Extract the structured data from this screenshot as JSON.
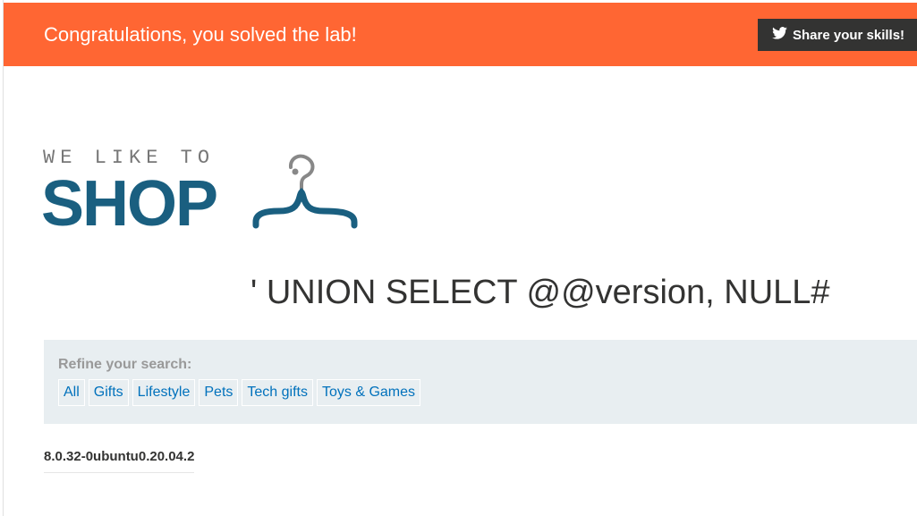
{
  "banner": {
    "message": "Congratulations, you solved the lab!",
    "share_label": "Share your skills!",
    "background_color": "#ff6633",
    "share_icon": "twitter-icon"
  },
  "logo": {
    "tagline": "WE LIKE TO",
    "name": "SHOP",
    "icon": "hanger-icon",
    "brand_color": "#1a5f80"
  },
  "search": {
    "heading": "' UNION SELECT @@version, NULL#"
  },
  "filters": {
    "label": "Refine your search:",
    "categories": [
      "All",
      "Gifts",
      "Lifestyle",
      "Pets",
      "Tech gifts",
      "Toys & Games"
    ],
    "link_color": "#0071bc"
  },
  "results": [
    "8.0.32-0ubuntu0.20.04.2"
  ]
}
